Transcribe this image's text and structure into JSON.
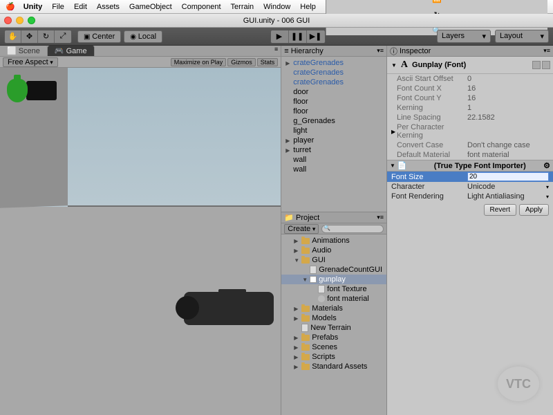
{
  "menubar": {
    "app": "Unity",
    "items": [
      "File",
      "Edit",
      "Assets",
      "GameObject",
      "Component",
      "Terrain",
      "Window",
      "Help"
    ]
  },
  "window_title": "GUI.unity - 006 GUI",
  "toolbar": {
    "pivot_center": "Center",
    "pivot_local": "Local",
    "layers": "Layers",
    "layout": "Layout"
  },
  "tabs": {
    "scene": "Scene",
    "game": "Game"
  },
  "gameview": {
    "aspect": "Free Aspect",
    "maximize": "Maximize on Play",
    "gizmos": "Gizmos",
    "stats": "Stats"
  },
  "hierarchy": {
    "title": "Hierarchy",
    "items": [
      {
        "label": "crateGrenades",
        "blue": true,
        "arrow": true
      },
      {
        "label": "crateGrenades",
        "blue": true
      },
      {
        "label": "crateGrenades",
        "blue": true
      },
      {
        "label": "door"
      },
      {
        "label": "floor"
      },
      {
        "label": "floor"
      },
      {
        "label": "g_Grenades"
      },
      {
        "label": "light"
      },
      {
        "label": "player",
        "arrow": true
      },
      {
        "label": "turret",
        "arrow": true
      },
      {
        "label": "wall"
      },
      {
        "label": "wall"
      }
    ]
  },
  "project": {
    "title": "Project",
    "create": "Create",
    "items": [
      {
        "label": "Animations",
        "type": "folder",
        "indent": 1
      },
      {
        "label": "Audio",
        "type": "folder",
        "indent": 1
      },
      {
        "label": "GUI",
        "type": "folder",
        "indent": 1,
        "open": true
      },
      {
        "label": "GrenadeCountGUI",
        "type": "file",
        "indent": 2
      },
      {
        "label": "gunplay",
        "type": "font",
        "indent": 2,
        "open": true,
        "selected": true
      },
      {
        "label": "font Texture",
        "type": "file",
        "indent": 3
      },
      {
        "label": "font material",
        "type": "mat",
        "indent": 3
      },
      {
        "label": "Materials",
        "type": "folder",
        "indent": 1
      },
      {
        "label": "Models",
        "type": "folder",
        "indent": 1
      },
      {
        "label": "New Terrain",
        "type": "file",
        "indent": 1
      },
      {
        "label": "Prefabs",
        "type": "folder",
        "indent": 1
      },
      {
        "label": "Scenes",
        "type": "folder",
        "indent": 1
      },
      {
        "label": "Scripts",
        "type": "folder",
        "indent": 1
      },
      {
        "label": "Standard Assets",
        "type": "folder",
        "indent": 1
      }
    ]
  },
  "inspector": {
    "title": "Inspector",
    "asset_name": "Gunplay (Font)",
    "font_props": [
      {
        "label": "Ascii Start Offset",
        "value": "0"
      },
      {
        "label": "Font Count X",
        "value": "16"
      },
      {
        "label": "Font Count Y",
        "value": "16"
      },
      {
        "label": "Kerning",
        "value": "1"
      },
      {
        "label": "Line Spacing",
        "value": "22.1582"
      },
      {
        "label": "Per Character Kerning"
      },
      {
        "label": "Convert Case",
        "value": "Don't change case"
      },
      {
        "label": "Default Material",
        "value": "font material"
      }
    ],
    "importer_title": "(True Type Font Importer)",
    "importer_props": {
      "font_size_label": "Font Size",
      "font_size_value": "20",
      "character_label": "Character",
      "character_value": "Unicode",
      "rendering_label": "Font Rendering",
      "rendering_value": "Light Antialiasing"
    },
    "revert": "Revert",
    "apply": "Apply"
  },
  "watermark": "VTC"
}
